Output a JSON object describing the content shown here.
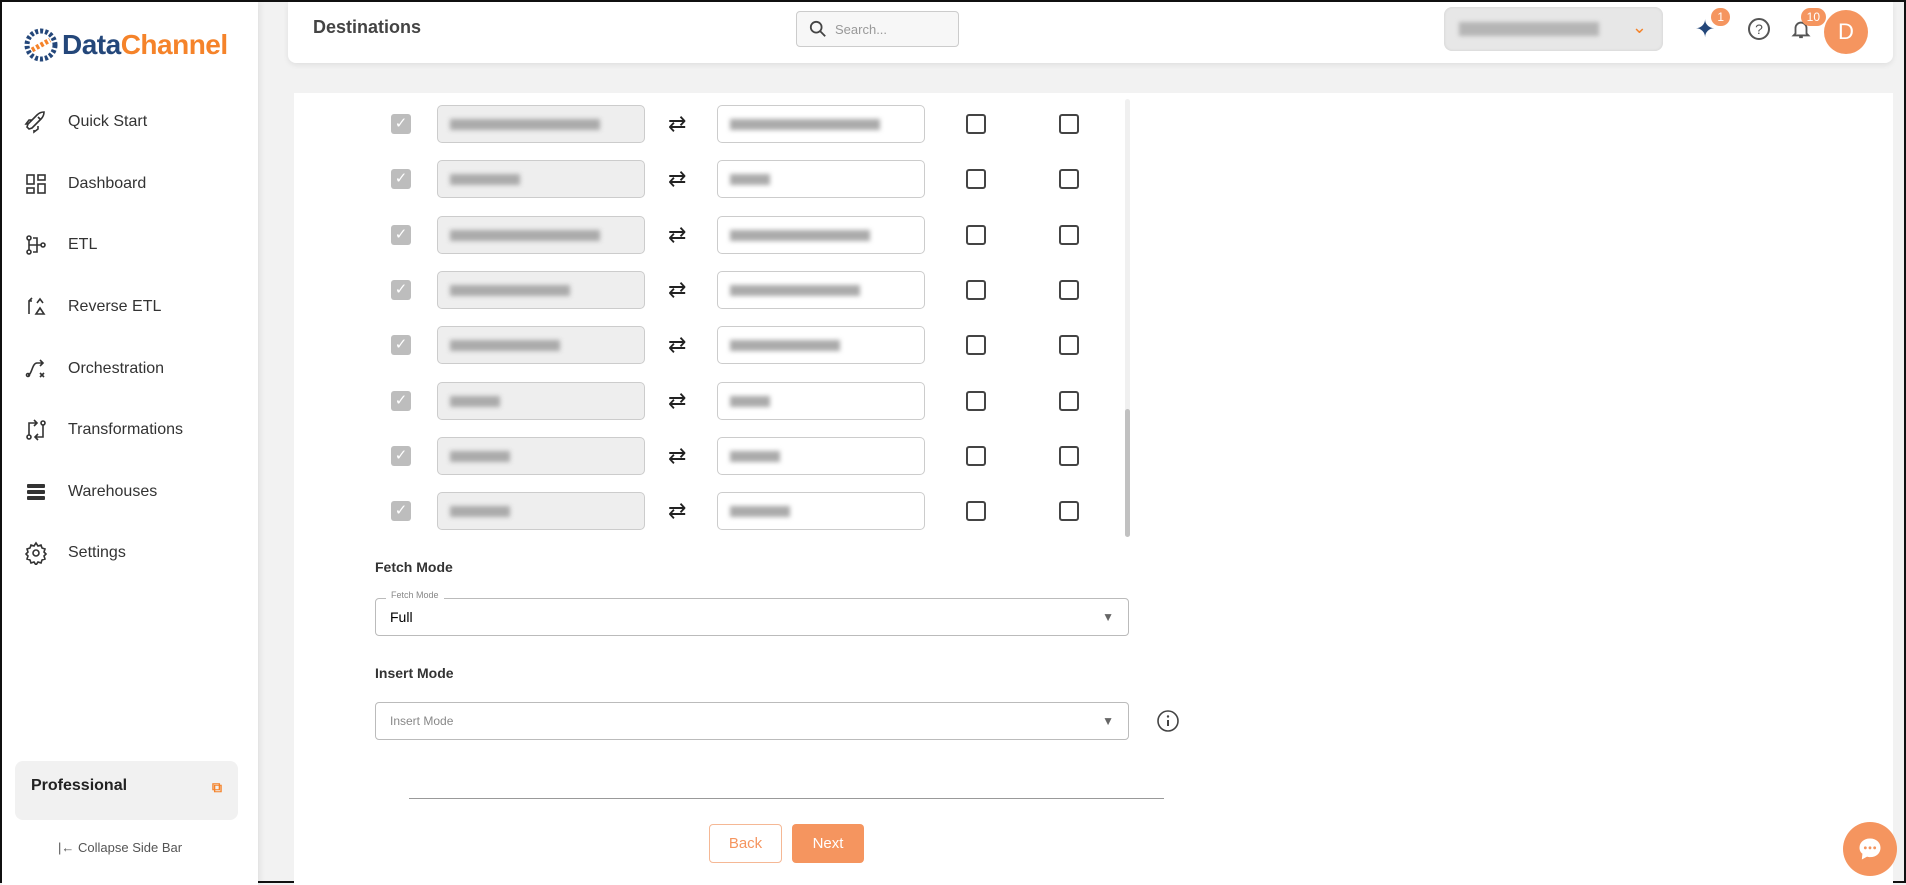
{
  "brand": {
    "part1": "Data",
    "part2": "Channel"
  },
  "sidebar": {
    "items": [
      {
        "label": "Quick Start",
        "icon": "rocket-icon"
      },
      {
        "label": "Dashboard",
        "icon": "dashboard-icon"
      },
      {
        "label": "ETL",
        "icon": "etl-icon"
      },
      {
        "label": "Reverse ETL",
        "icon": "reverse-etl-icon"
      },
      {
        "label": "Orchestration",
        "icon": "orchestration-icon"
      },
      {
        "label": "Transformations",
        "icon": "transformations-icon"
      },
      {
        "label": "Warehouses",
        "icon": "warehouses-icon"
      },
      {
        "label": "Settings",
        "icon": "gear-icon"
      }
    ],
    "plan": "Professional",
    "collapse": "Collapse Side Bar"
  },
  "header": {
    "title": "Destinations",
    "search_placeholder": "Search...",
    "ai_badge": "1",
    "notif_badge": "10",
    "avatar": "D"
  },
  "colors": {
    "accent": "#f5955f",
    "brand_blue": "#24477a",
    "brand_orange": "#f5832a"
  },
  "mapping_rows": 8,
  "fetch": {
    "label": "Fetch Mode",
    "legend": "Fetch Mode",
    "value": "Full"
  },
  "insert": {
    "label": "Insert Mode",
    "placeholder": "Insert Mode"
  },
  "buttons": {
    "back": "Back",
    "next": "Next"
  }
}
